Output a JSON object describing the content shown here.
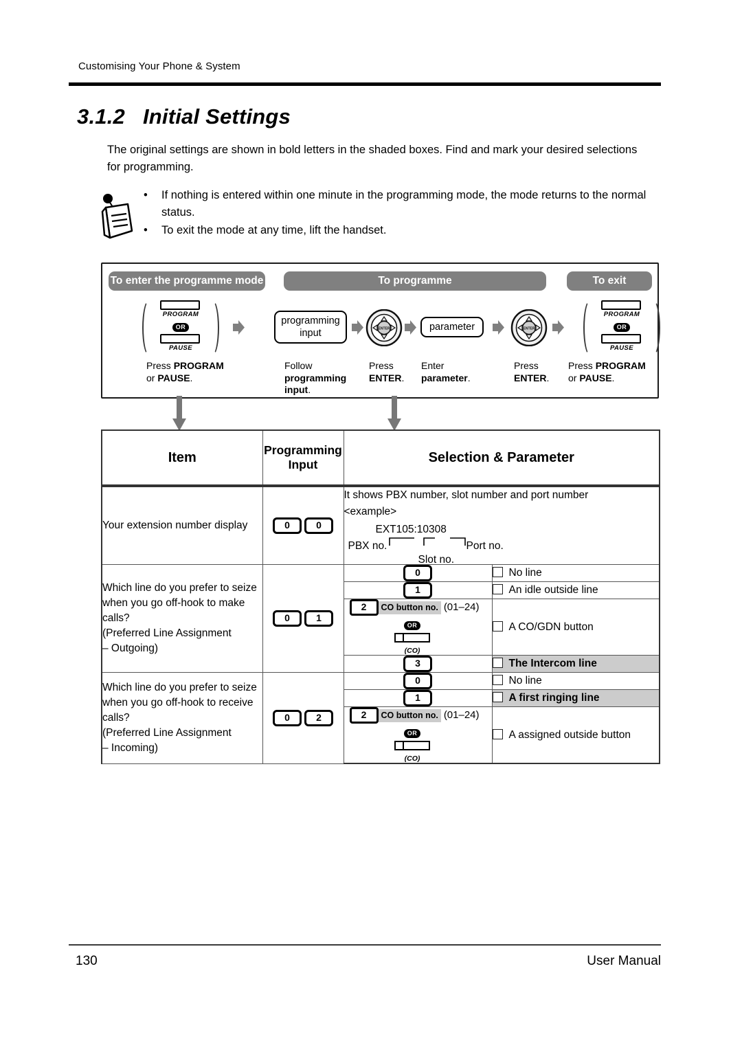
{
  "page": {
    "running_head": "Customising Your Phone & System",
    "section_number": "3.1.2",
    "section_title": "Initial Settings",
    "intro": "The original settings are shown in bold letters in the shaded boxes. Find and mark your desired selections for programming.",
    "footer_page_number": "130",
    "footer_label": "User Manual",
    "colors": {
      "banner_grey": "#808080",
      "shaded_row_grey": "#cccccc",
      "arrow_grey": "#808080",
      "rule_black": "#000000"
    }
  },
  "note": {
    "icon": "note-paper-icon",
    "bullet": "•",
    "items": [
      "If nothing is entered within one minute in the programming mode, the mode returns to the normal status.",
      "To exit the mode at any time, lift the handset."
    ]
  },
  "procedure": {
    "banners": [
      {
        "label": "To enter the programme mode"
      },
      {
        "label": "To programme"
      },
      {
        "label": "To exit"
      }
    ],
    "steps": [
      {
        "type": "key-pair",
        "key_top": "PROGRAM",
        "or": "OR",
        "key_bottom": "PAUSE",
        "caption_line1": "Press ",
        "caption_bold1": "PROGRAM",
        "caption_line2": "or ",
        "caption_bold2": "PAUSE",
        "caption_tail": "."
      },
      {
        "type": "label-box",
        "label_line1": "programming",
        "label_line2": "input",
        "caption_plain": "Follow",
        "caption_bold": "programming input",
        "caption_tail": "."
      },
      {
        "type": "navigator",
        "center_label": "ENTER",
        "caption_plain": "Press",
        "caption_bold": "ENTER",
        "caption_tail": "."
      },
      {
        "type": "label-box",
        "label_line1": "parameter",
        "caption_plain": "Enter",
        "caption_bold": "parameter",
        "caption_tail": "."
      },
      {
        "type": "navigator",
        "center_label": "ENTER",
        "caption_plain": "Press",
        "caption_bold": "ENTER",
        "caption_tail": "."
      },
      {
        "type": "key-pair",
        "key_top": "PROGRAM",
        "or": "OR",
        "key_bottom": "PAUSE",
        "caption_line1": "Press ",
        "caption_bold1": "PROGRAM",
        "caption_line2": "or ",
        "caption_bold2": "PAUSE",
        "caption_tail": "."
      }
    ]
  },
  "table": {
    "headers": {
      "item": "Item",
      "programming_input_line1": "Programming",
      "programming_input_line2": "Input",
      "selection": "Selection & Parameter"
    },
    "rows": [
      {
        "item": "Your extension number display",
        "programming_input": [
          "0",
          "0"
        ],
        "selection_text": "It shows PBX number, slot number and port number",
        "example_label": "<example>",
        "example_value": "EXT105:10308",
        "example_pbx": "PBX no.",
        "example_slot": "Slot no.",
        "example_port": "Port no."
      },
      {
        "item_line1": "Which line do you prefer to seize when you go off-hook to make calls?",
        "item_line2": "(Preferred Line Assignment",
        "item_line3": "– Outgoing)",
        "programming_input": [
          "0",
          "1"
        ],
        "options": [
          {
            "code": "0",
            "label": "No line",
            "shaded": false
          },
          {
            "code": "1",
            "label": "An idle outside line",
            "shaded": false
          },
          {
            "code": "2",
            "tag": "CO button no.",
            "range": "(01–24)",
            "or": "OR",
            "co_glyph_label": "(CO)",
            "label": "A CO/GDN button",
            "shaded": false
          },
          {
            "code": "3",
            "label": "The Intercom line",
            "shaded": true
          }
        ]
      },
      {
        "item_line1": "Which line do you prefer to seize when you go off-hook to receive calls?",
        "item_line2": "(Preferred Line Assignment",
        "item_line3": "– Incoming)",
        "programming_input": [
          "0",
          "2"
        ],
        "options": [
          {
            "code": "0",
            "label": "No line",
            "shaded": false
          },
          {
            "code": "1",
            "label": "A first ringing line",
            "shaded": true
          },
          {
            "code": "2",
            "tag": "CO button no.",
            "range": "(01–24)",
            "or": "OR",
            "co_glyph_label": "(CO)",
            "label": "A assigned outside button",
            "shaded": false
          }
        ]
      }
    ]
  }
}
